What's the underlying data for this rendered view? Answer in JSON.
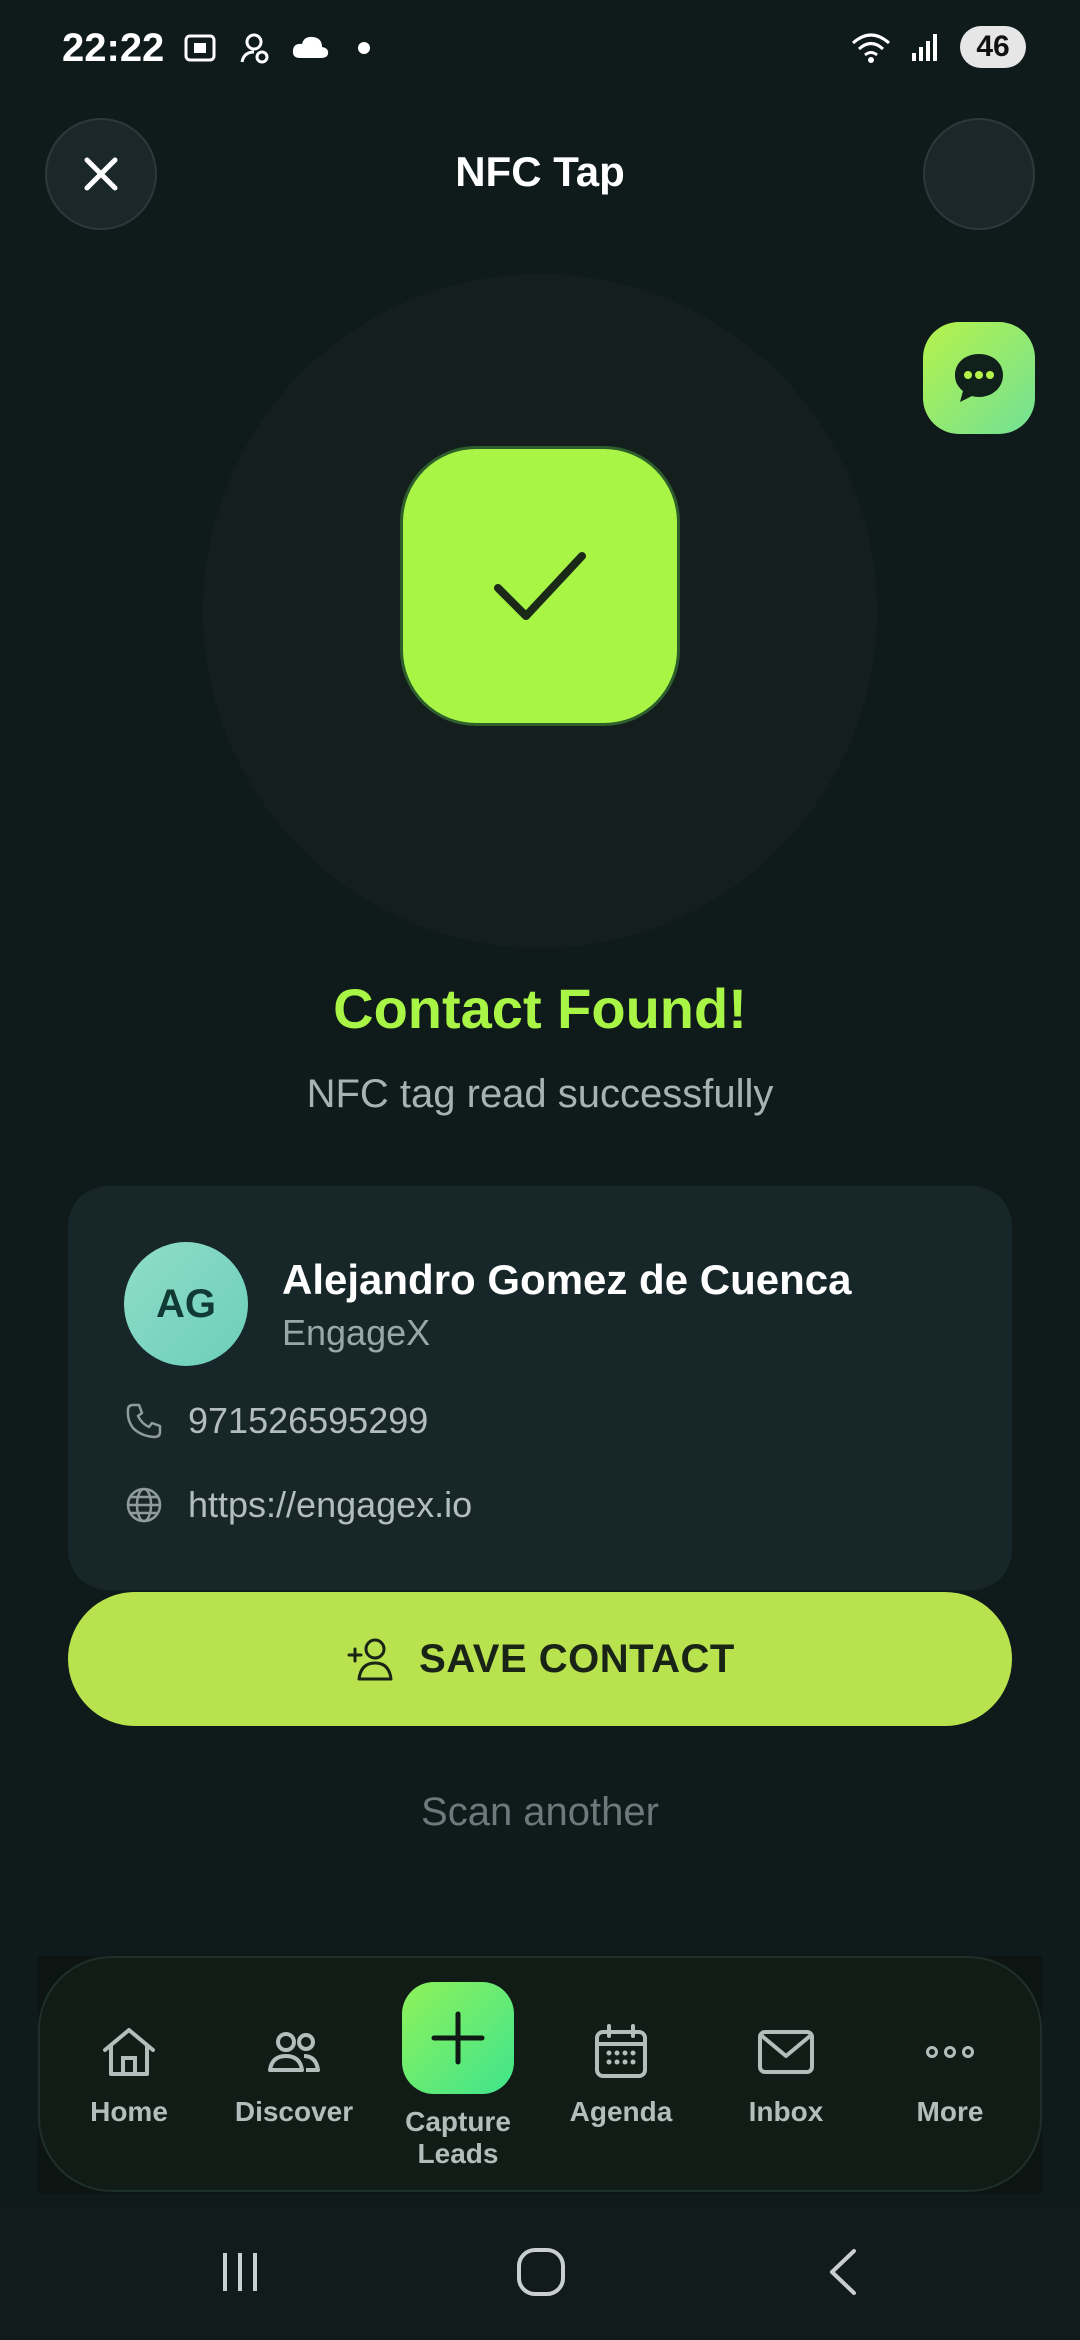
{
  "status_bar": {
    "time": "22:22",
    "battery": "46"
  },
  "header": {
    "title": "NFC Tap"
  },
  "result": {
    "title": "Contact Found!",
    "subtitle": "NFC tag read successfully"
  },
  "contact": {
    "initials": "AG",
    "name": "Alejandro Gomez de Cuenca",
    "company": "EngageX",
    "phone": "971526595299",
    "website": "https://engagex.io"
  },
  "actions": {
    "save_label": "SAVE CONTACT",
    "scan_another": "Scan another"
  },
  "nav": {
    "items": [
      {
        "label": "Home",
        "icon": "home-icon"
      },
      {
        "label": "Discover",
        "icon": "people-icon"
      },
      {
        "label": "Capture\nLeads",
        "icon": "plus-icon"
      },
      {
        "label": "Agenda",
        "icon": "calendar-icon"
      },
      {
        "label": "Inbox",
        "icon": "mail-icon"
      },
      {
        "label": "More",
        "icon": "more-icon"
      }
    ],
    "center_line1": "Capture",
    "center_line2": "Leads"
  },
  "colors": {
    "background": "#0f1a1b",
    "accent": "#a8f545",
    "save_button": "#b9e24f",
    "card": "#172729"
  }
}
